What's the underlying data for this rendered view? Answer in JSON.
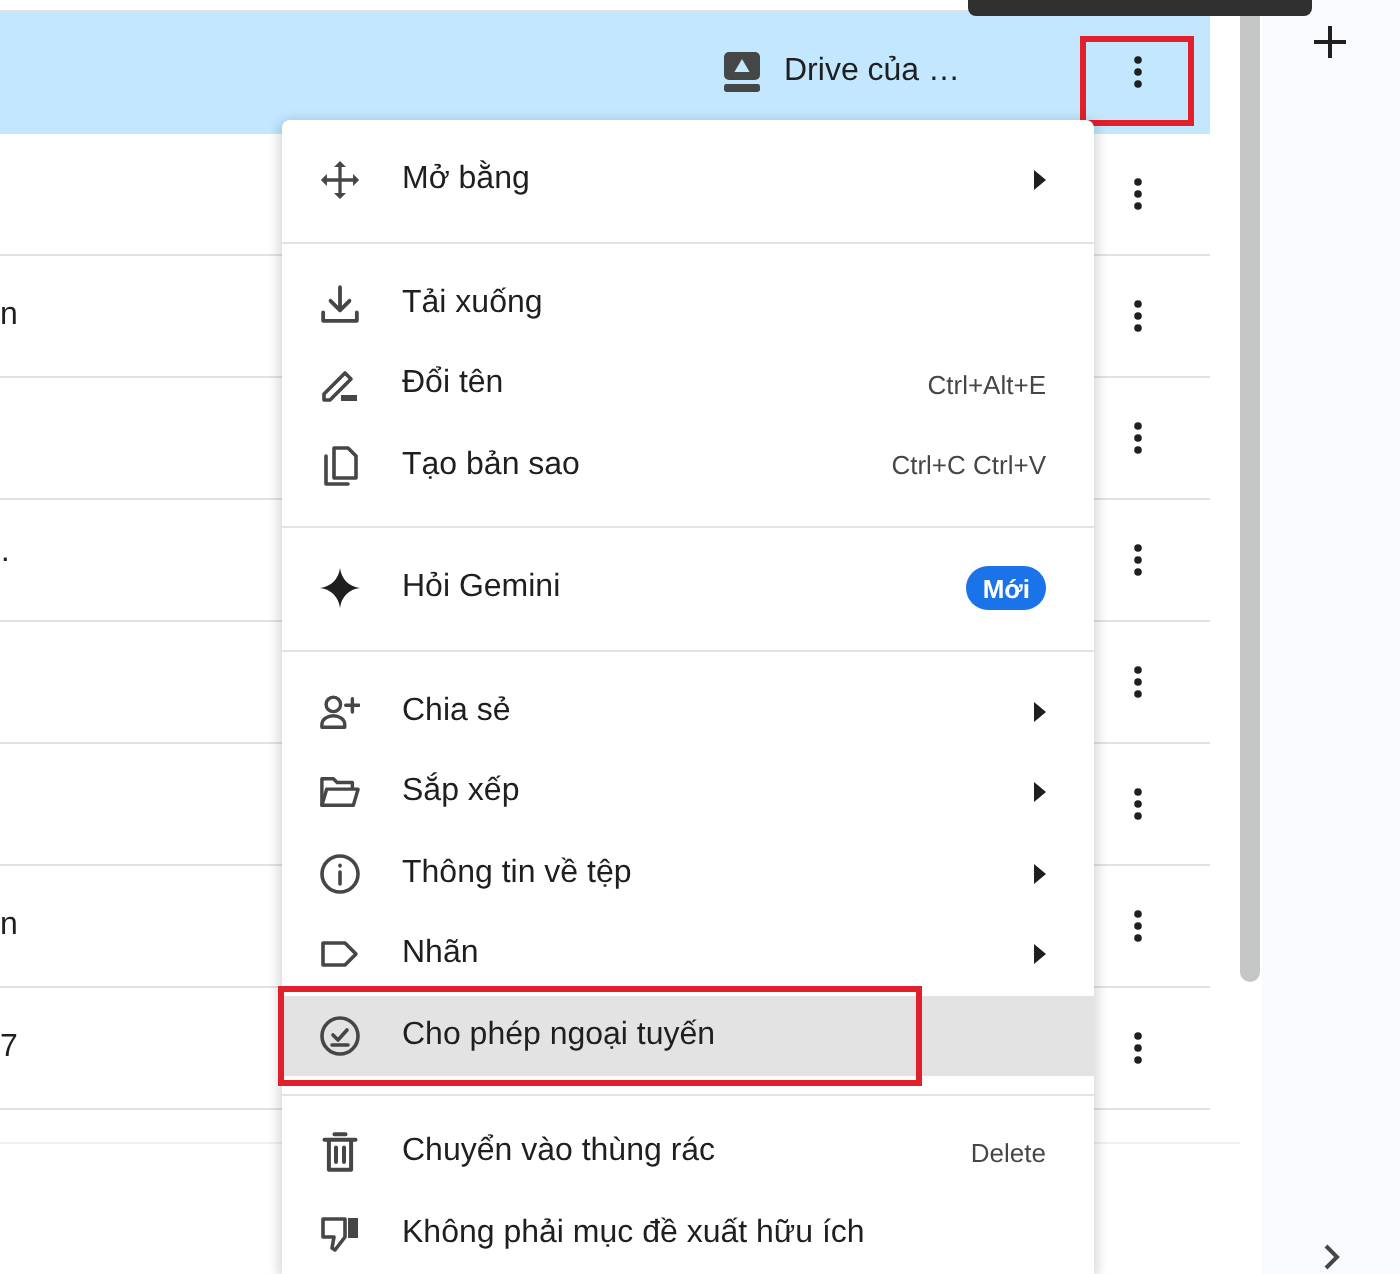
{
  "file_list": {
    "rows": [
      {
        "selected": true,
        "location": "Drive của …",
        "more_annotated": true
      },
      {
        "selected": false,
        "more_annotated": false
      },
      {
        "selected": false,
        "column_1": "n",
        "more_annotated": false
      },
      {
        "selected": false,
        "more_annotated": false
      },
      {
        "selected": false,
        "column_1": "·",
        "more_annotated": false
      },
      {
        "selected": false,
        "more_annotated": false
      },
      {
        "selected": false,
        "more_annotated": false
      },
      {
        "selected": false,
        "column_1": "n",
        "more_annotated": false
      },
      {
        "selected": false,
        "column_1": "7",
        "more_annotated": false
      }
    ]
  },
  "context_menu": {
    "sections": [
      {
        "items": [
          {
            "label": "Mở bằng",
            "submenu": true,
            "hovered": false,
            "annotated": false
          }
        ]
      },
      {
        "items": [
          {
            "label": "Tải xuống",
            "submenu": false,
            "hovered": false,
            "annotated": false
          },
          {
            "label": "Đổi tên",
            "shortcut": "Ctrl+Alt+E",
            "submenu": false,
            "hovered": false,
            "annotated": false
          },
          {
            "label": "Tạo bản sao",
            "shortcut": "Ctrl+C Ctrl+V",
            "submenu": false,
            "hovered": false,
            "annotated": false
          }
        ]
      },
      {
        "items": [
          {
            "label": "Hỏi Gemini",
            "badge": "Mới",
            "submenu": false,
            "hovered": false,
            "annotated": false
          }
        ]
      },
      {
        "items": [
          {
            "label": "Chia sẻ",
            "submenu": true,
            "hovered": false,
            "annotated": false
          },
          {
            "label": "Sắp xếp",
            "submenu": true,
            "hovered": false,
            "annotated": false
          },
          {
            "label": "Thông tin về tệp",
            "submenu": true,
            "hovered": false,
            "annotated": false
          },
          {
            "label": "Nhãn",
            "submenu": true,
            "hovered": false,
            "annotated": false
          },
          {
            "label": "Cho phép ngoại tuyến",
            "submenu": false,
            "hovered": true,
            "annotated": true
          }
        ]
      },
      {
        "items": [
          {
            "label": "Chuyển vào thùng rác",
            "shortcut": "Delete",
            "submenu": false,
            "hovered": false,
            "annotated": false
          },
          {
            "label": "Không phải mục đề xuất hữu ích",
            "submenu": false,
            "hovered": false,
            "annotated": false
          }
        ]
      }
    ]
  }
}
